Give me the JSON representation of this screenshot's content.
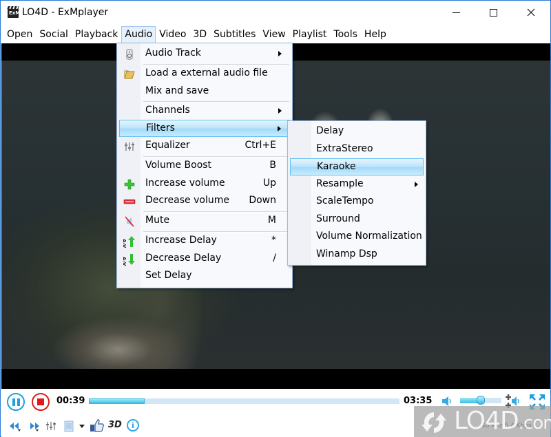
{
  "window": {
    "title": "LO4D - ExMplayer",
    "icon_label": "ExM",
    "controls": [
      "minimize",
      "maximize",
      "close"
    ]
  },
  "menubar": {
    "items": [
      {
        "label": "Open"
      },
      {
        "label": "Social"
      },
      {
        "label": "Playback"
      },
      {
        "label": "Audio",
        "active": true
      },
      {
        "label": "Video"
      },
      {
        "label": "3D"
      },
      {
        "label": "Subtitles"
      },
      {
        "label": "View"
      },
      {
        "label": "Playlist"
      },
      {
        "label": "Tools"
      },
      {
        "label": "Help"
      }
    ]
  },
  "audio_menu": {
    "items": [
      {
        "label": "Audio Track",
        "icon": "speaker-icon",
        "submenu": true
      },
      {
        "label": "Load a external audio file",
        "icon": "folder-icon"
      },
      {
        "label": "Mix and save"
      },
      {
        "label": "Channels",
        "submenu": true
      },
      {
        "label": "Filters",
        "submenu": true,
        "highlighted": true
      },
      {
        "label": "Equalizer",
        "icon": "equalizer-icon",
        "shortcut": "Ctrl+E"
      },
      {
        "label": "Volume Boost",
        "shortcut": "B"
      },
      {
        "label": "Increase volume",
        "icon": "plus-icon",
        "shortcut": "Up"
      },
      {
        "label": "Decrease volume",
        "icon": "minus-icon",
        "shortcut": "Down"
      },
      {
        "label": "Mute",
        "icon": "mute-icon",
        "shortcut": "M"
      },
      {
        "label": "Increase Delay",
        "icon": "delay-up-icon",
        "shortcut": "*"
      },
      {
        "label": "Decrease Delay",
        "icon": "delay-down-icon",
        "shortcut": "/"
      },
      {
        "label": "Set Delay"
      }
    ]
  },
  "filters_submenu": {
    "items": [
      {
        "label": "Delay"
      },
      {
        "label": "ExtraStereo"
      },
      {
        "label": "Karaoke",
        "highlighted": true
      },
      {
        "label": "Resample",
        "submenu": true
      },
      {
        "label": "ScaleTempo"
      },
      {
        "label": "Surround"
      },
      {
        "label": "Volume Normalization"
      },
      {
        "label": "Winamp Dsp"
      }
    ]
  },
  "playback": {
    "current_time": "00:39",
    "total_time": "03:35",
    "progress_fraction": 0.18,
    "volume_fraction": 0.5,
    "three_d_label": "3D",
    "info_label": "i",
    "status_text": "48 Khz 5 4 Kbps"
  },
  "watermark": {
    "text": "LO4D",
    "suffix": ".com"
  },
  "colors": {
    "accent_blue": "#1ea0e0",
    "stop_red": "#e01a1a",
    "menu_highlight_border": "#62bff0",
    "window_border": "#2b7bd4"
  }
}
